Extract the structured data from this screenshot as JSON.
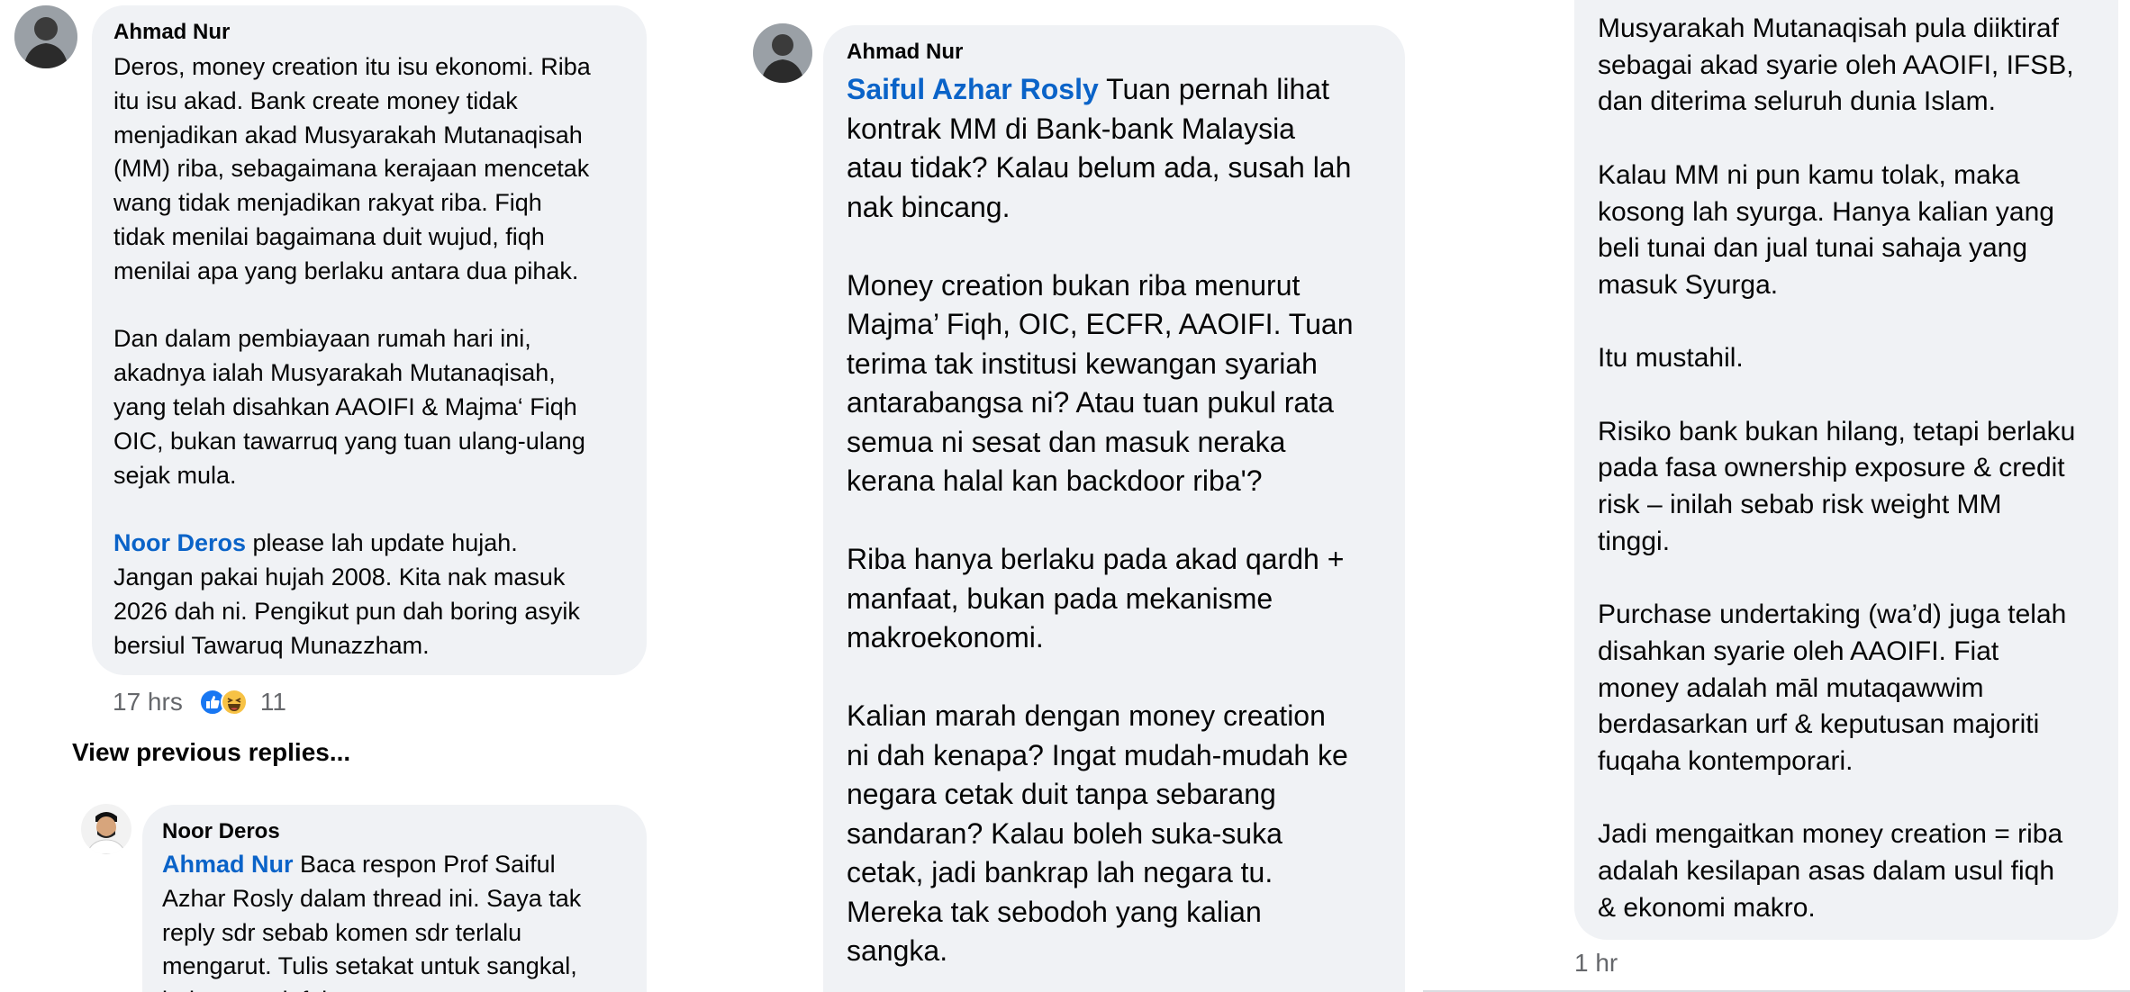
{
  "left": {
    "comment1": {
      "author": "Ahmad Nur",
      "avatar_icon": "user-avatar-icon",
      "paragraphs": [
        "Deros, money creation itu isu ekonomi. Riba\nitu isu akad. Bank create money tidak\nmenjadikan akad Musyarakah Mutanaqisah\n(MM) riba, sebagaimana kerajaan mencetak\nwang tidak menjadikan rakyat riba. Fiqh\ntidak menilai bagaimana duit wujud, fiqh\nmenilai apa yang berlaku antara dua pihak.",
        "Dan dalam pembiayaan rumah hari ini,\nakadnya ialah Musyarakah Mutanaqisah,\nyang telah disahkan AAOIFI & Majma‘ Fiqh\nOIC, bukan tawarruq yang tuan ulang-ulang\nsejak mula."
      ],
      "mention": "Noor Deros",
      "mention_rest": " please lah update hujah.\nJangan pakai hujah 2008. Kita nak masuk\n2026 dah ni. Pengikut pun dah boring asyik\nbersiul Tawaruq Munazzham.",
      "time": "17 hrs",
      "reaction_count": "11",
      "reactions": [
        "like-reaction-icon",
        "haha-reaction-icon"
      ]
    },
    "view_previous": "View previous replies...",
    "comment2": {
      "author": "Noor Deros",
      "avatar_icon": "user-avatar-icon",
      "mention": "Ahmad Nur",
      "text": " Baca respon Prof Saiful\nAzhar Rosly dalam thread ini. Saya tak\nreply sdr sebab komen sdr terlalu\nmengarut. Tulis setakat untuk sangkal,\nbukan untuk faham."
    }
  },
  "middle": {
    "comment": {
      "author": "Ahmad Nur",
      "avatar_icon": "user-avatar-icon",
      "mention": "Saiful Azhar Rosly",
      "first_rest": " Tuan pernah lihat\nkontrak MM di Bank-bank Malaysia\natau tidak? Kalau belum ada, susah lah\nnak bincang.",
      "paragraphs": [
        "Money creation bukan riba menurut\nMajma’ Fiqh, OIC, ECFR, AAOIFI. Tuan\nterima tak institusi kewangan syariah\nantarabangsa ni? Atau tuan pukul rata\nsemua ni sesat dan masuk neraka\nkerana halal kan backdoor riba'?",
        "Riba hanya berlaku pada akad qardh +\nmanfaat, bukan pada mekanisme\nmakroekonomi.",
        "Kalian marah dengan money creation\nni dah kenapa? Ingat mudah-mudah ke\nnegara cetak duit tanpa sebarang\nsandaran? Kalau boleh suka-suka\ncetak, jadi bankrap lah negara tu.\nMereka tak sebodoh yang kalian\nsangka."
      ]
    }
  },
  "right": {
    "comment": {
      "paragraphs": [
        "Musyarakah Mutanaqisah pula diiktiraf\nsebagai akad syarie oleh AAOIFI, IFSB,\ndan diterima seluruh dunia Islam.",
        "Kalau MM ni pun kamu tolak, maka\nkosong lah syurga. Hanya kalian yang\nbeli tunai dan jual tunai sahaja yang\nmasuk Syurga.",
        "Itu mustahil.",
        "Risiko bank bukan hilang, tetapi berlaku\npada fasa ownership exposure & credit\nrisk – inilah sebab risk weight MM\ntinggi.",
        "Purchase undertaking (wa’d) juga telah\ndisahkan syarie oleh AAOIFI. Fiat\nmoney adalah māl mutaqawwim\nberdasarkan urf & keputusan majoriti\nfuqaha kontemporari.",
        "Jadi mengaitkan money creation = riba\nadalah kesilapan asas dalam usul fiqh\n& ekonomi makro."
      ],
      "time": "1 hr"
    }
  },
  "colors": {
    "bubble": "#f0f2f5",
    "mention": "#0a63c8",
    "meta": "#65676b",
    "text": "#050505"
  }
}
